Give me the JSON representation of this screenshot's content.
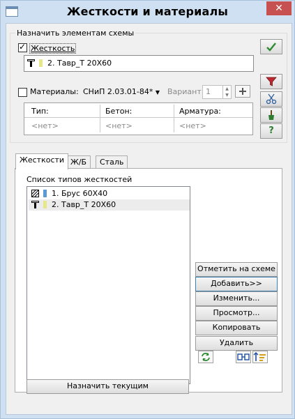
{
  "window": {
    "title": "Жесткости и материалы",
    "close_label": "✕"
  },
  "assign": {
    "group_label": "Назначить элементам схемы",
    "stiffness_checkbox_label": "Жесткость",
    "stiffness_checked": true,
    "stiffness_value": "2. Тавр_Т 20Х60",
    "stiffness_color": "#e6e68a",
    "materials_checkbox_label": "Материалы:",
    "materials_checked": false,
    "norm_dropdown": "СНиП 2.03.01-84*",
    "variant_label": "Вариант",
    "variant_value": "1"
  },
  "materials_grid": {
    "headers": [
      "Тип:",
      "Бетон:",
      "Арматура:"
    ],
    "values": [
      "<нет>",
      "<нет>",
      "<нет>"
    ]
  },
  "side_buttons": {
    "apply_icon": "checkmark-icon",
    "filter_icon": "filter-icon",
    "cut_icon": "scissors-icon",
    "brush_icon": "brush-icon",
    "help_label": "?"
  },
  "tabs": [
    {
      "label": "Жесткости",
      "active": true
    },
    {
      "label": "Ж/Б",
      "active": false
    },
    {
      "label": "Сталь",
      "active": false
    }
  ],
  "stiffness_list": {
    "label": "Список типов жесткостей",
    "items": [
      {
        "label": "1. Брус 60Х40",
        "icon": "rect-section-icon",
        "color": "#5b9bd5",
        "selected": false
      },
      {
        "label": "2. Тавр_Т 20Х60",
        "icon": "tee-section-icon",
        "color": "#e6e68a",
        "selected": true
      }
    ]
  },
  "action_buttons": {
    "mark": "Отметить на схеме",
    "add": "Добавить>>",
    "edit": "Изменить...",
    "view": "Просмотр...",
    "copy": "Копировать",
    "delete": "Удалить"
  },
  "assign_current": "Назначить текущим"
}
